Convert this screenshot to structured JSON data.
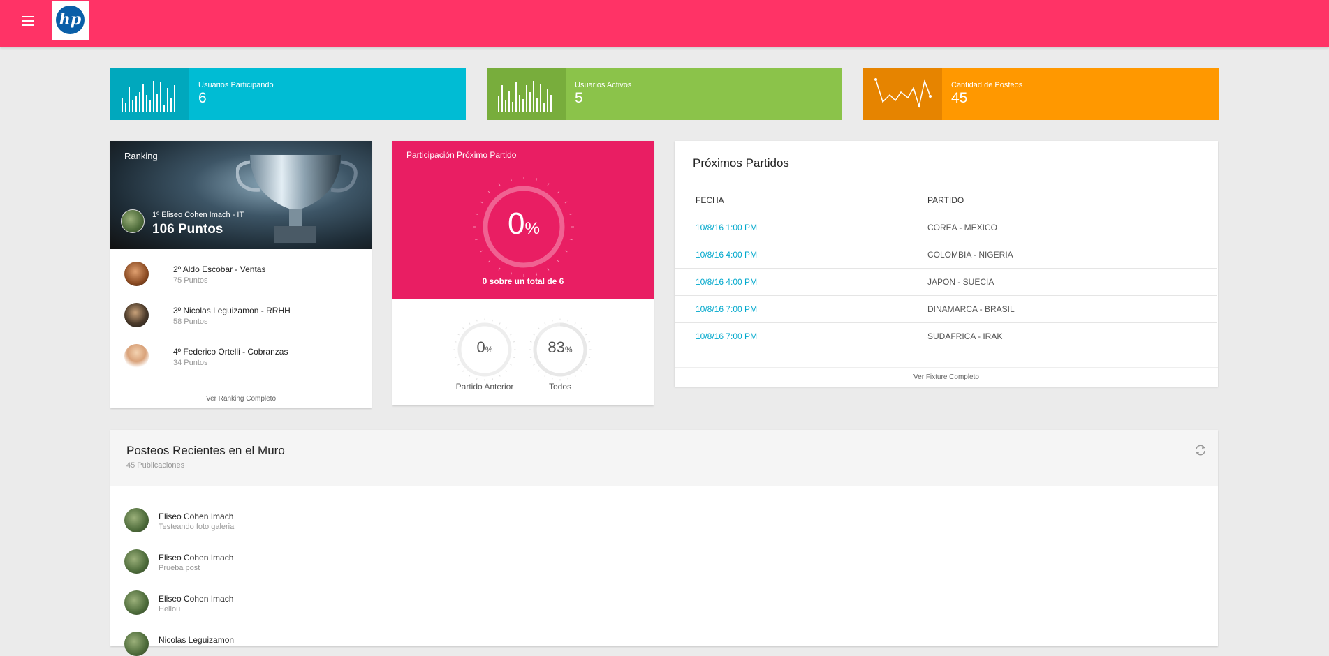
{
  "header": {
    "logo_text": "hp",
    "colors": {
      "bar": "#ff3366"
    }
  },
  "stats": [
    {
      "label": "Usuarios Participando",
      "value": "6",
      "icon": "bar-chart-icon",
      "color": "#00bcd4",
      "icon_bg": "#00a8bd"
    },
    {
      "label": "Usuarios Activos",
      "value": "5",
      "icon": "bar-chart-icon",
      "color": "#8bc34a",
      "icon_bg": "#78ad3c"
    },
    {
      "label": "Cantidad de Posteos",
      "value": "45",
      "icon": "line-chart-icon",
      "color": "#ff9800",
      "icon_bg": "#e68400"
    }
  ],
  "ranking": {
    "title": "Ranking",
    "leader": {
      "name": "1º Eliseo Cohen Imach - IT",
      "points": "106 Puntos"
    },
    "items": [
      {
        "name": "2º Aldo Escobar - Ventas",
        "points": "75 Puntos"
      },
      {
        "name": "3º Nicolas Leguizamon - RRHH",
        "points": "58 Puntos"
      },
      {
        "name": "4º Federico Ortelli - Cobranzas",
        "points": "34 Puntos"
      }
    ],
    "footer": "Ver Ranking Completo"
  },
  "participation": {
    "title": "Participación Próximo Partido",
    "main_value": "0",
    "main_fraction": 0,
    "unit": "%",
    "subtitle": "0 sobre un total de 6",
    "small": [
      {
        "value": "0",
        "fraction": 0,
        "label": "Partido Anterior"
      },
      {
        "value": "83",
        "fraction": 0.83,
        "label": "Todos"
      }
    ]
  },
  "matches": {
    "title": "Próximos Partidos",
    "columns": [
      "FECHA",
      "PARTIDO"
    ],
    "rows": [
      {
        "date": "10/8/16 1:00 PM",
        "match": "COREA - MEXICO"
      },
      {
        "date": "10/8/16 4:00 PM",
        "match": "COLOMBIA - NIGERIA"
      },
      {
        "date": "10/8/16 4:00 PM",
        "match": "JAPON - SUECIA"
      },
      {
        "date": "10/8/16 7:00 PM",
        "match": "DINAMARCA - BRASIL"
      },
      {
        "date": "10/8/16 7:00 PM",
        "match": "SUDAFRICA - IRAK"
      }
    ],
    "footer": "Ver Fixture Completo"
  },
  "posts": {
    "title": "Posteos Recientes en el Muro",
    "subtitle": "45 Publicaciones",
    "items": [
      {
        "author": "Eliseo Cohen Imach",
        "text": "Testeando foto galeria"
      },
      {
        "author": "Eliseo Cohen Imach",
        "text": "Prueba post"
      },
      {
        "author": "Eliseo Cohen Imach",
        "text": "Hellou"
      },
      {
        "author": "Nicolas Leguizamon",
        "text": ""
      }
    ]
  }
}
